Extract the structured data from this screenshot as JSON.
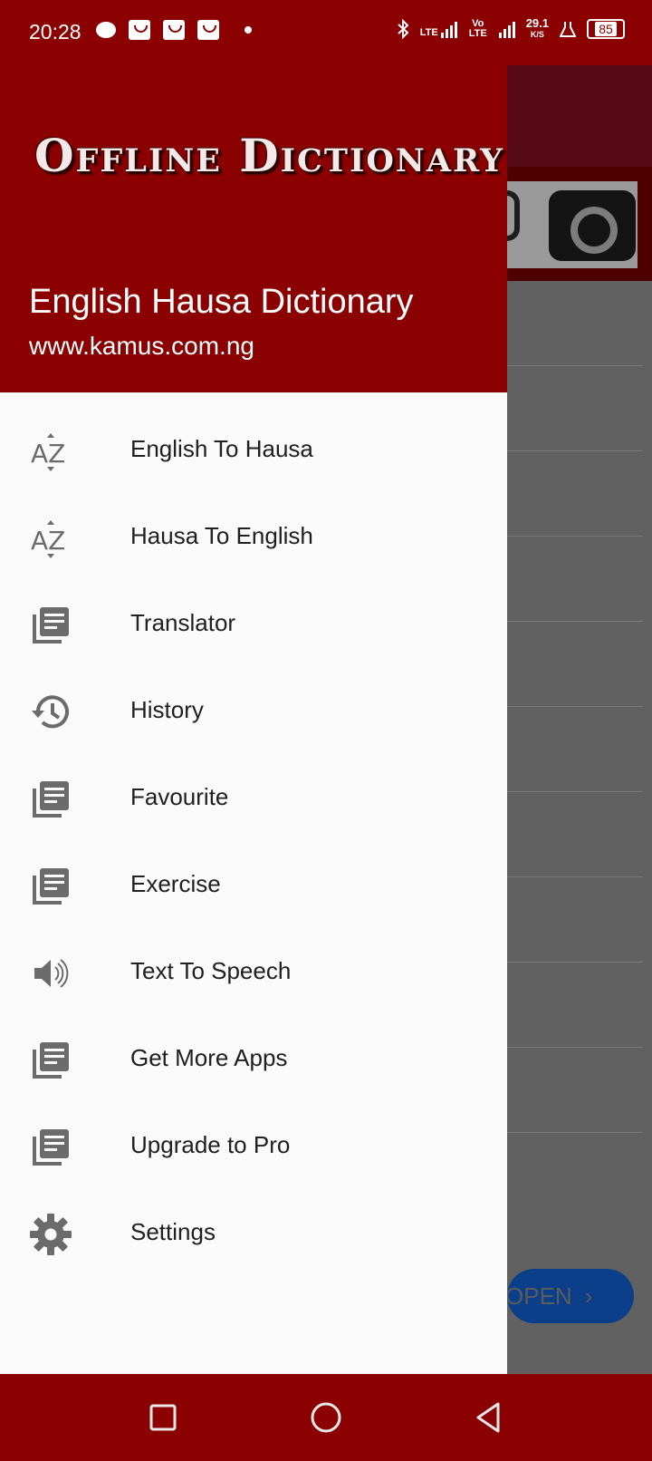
{
  "status_bar": {
    "time": "20:28",
    "net_speed": "29.1",
    "net_speed_unit": "K/S",
    "battery": "85",
    "lte_label": "LTE",
    "volte_label": "Vo LTE"
  },
  "background": {
    "ad_button_label": "OPEN",
    "mic_icon": "mic-icon",
    "camera_icon": "camera-icon"
  },
  "drawer": {
    "logo_text": "Offline Dictionary",
    "app_name": "English Hausa Dictionary",
    "website": "www.kamus.com.ng",
    "items": [
      {
        "label": "English To Hausa",
        "icon": "az-sort-icon"
      },
      {
        "label": "Hausa To English",
        "icon": "az-sort-icon"
      },
      {
        "label": "Translator",
        "icon": "library-books-icon"
      },
      {
        "label": "History",
        "icon": "history-icon"
      },
      {
        "label": "Favourite",
        "icon": "library-books-icon"
      },
      {
        "label": "Exercise",
        "icon": "library-books-icon"
      },
      {
        "label": "Text To Speech",
        "icon": "volume-icon"
      },
      {
        "label": "Get More Apps",
        "icon": "library-books-icon"
      },
      {
        "label": "Upgrade to Pro",
        "icon": "library-books-icon"
      },
      {
        "label": "Settings",
        "icon": "gear-icon"
      }
    ]
  },
  "colors": {
    "primary": "#8b0000",
    "drawer_bg": "#fafafa",
    "icon": "#6b6b6b",
    "text": "#202020"
  }
}
